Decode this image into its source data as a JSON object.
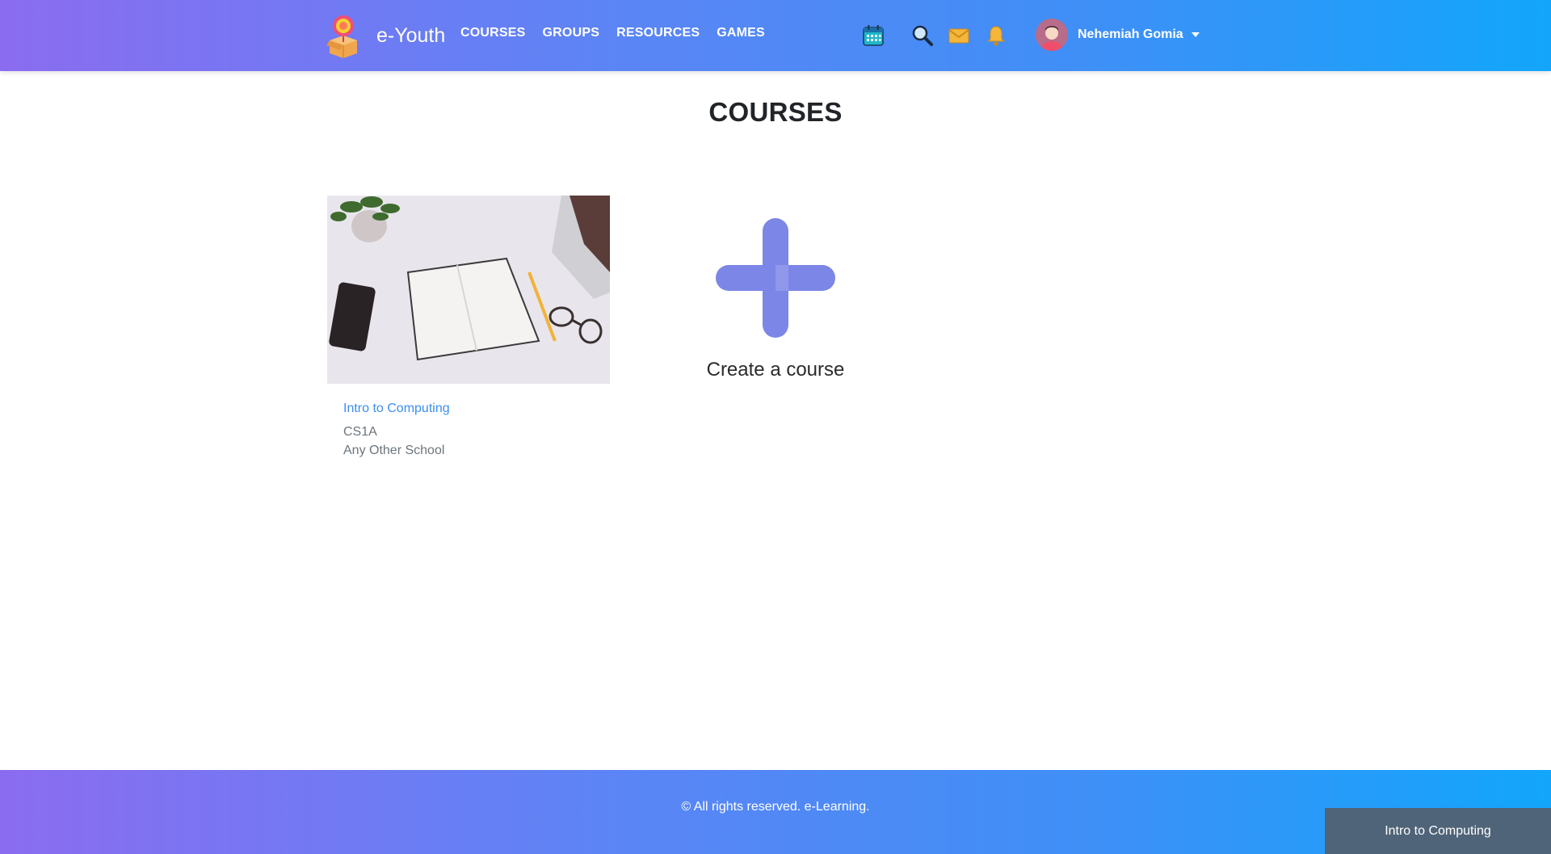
{
  "header": {
    "brand_name": "e-Youth",
    "nav": [
      {
        "label": "COURSES"
      },
      {
        "label": "GROUPS"
      },
      {
        "label": "RESOURCES"
      },
      {
        "label": "GAMES"
      }
    ],
    "icons": [
      "calendar-icon",
      "search-icon",
      "mail-icon",
      "bell-icon"
    ],
    "user_name": "Nehemiah Gomia"
  },
  "main": {
    "title": "COURSES",
    "courses": [
      {
        "title": "Intro to Computing",
        "code": "CS1A",
        "school": "Any Other School"
      }
    ],
    "create_label": "Create a course"
  },
  "footer": {
    "copyright": "© All rights reserved. e-Learning.",
    "floating_tab": "Intro to Computing"
  },
  "colors": {
    "gradient_start": "#8b6cf0",
    "gradient_end": "#12a6fb",
    "link": "#3d8ef0",
    "plus": "#7b86e6"
  }
}
